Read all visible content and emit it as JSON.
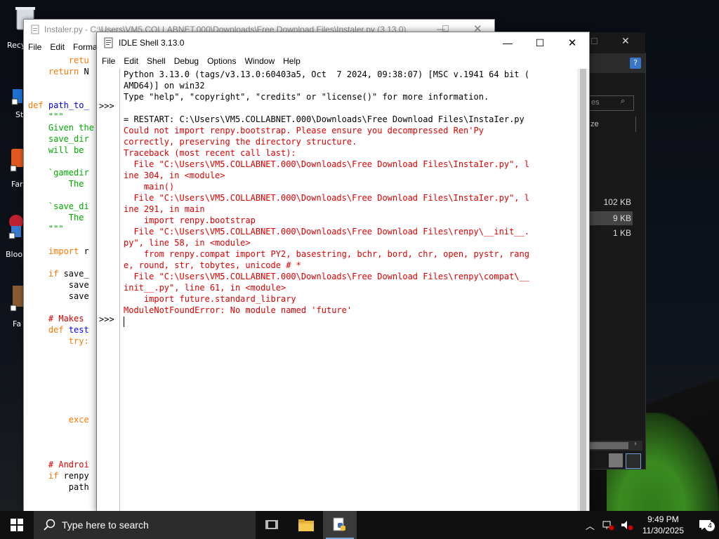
{
  "desktop": {
    "icons": [
      {
        "label": "Recy"
      },
      {
        "label": "St"
      },
      {
        "label": "Far"
      },
      {
        "label": "Bloo"
      },
      {
        "label": "Fa"
      }
    ]
  },
  "editor": {
    "title": "Instaler.py - C:\\Users\\VM5.COLLABNET.000\\Downloads\\Free Download Files\\Instaler.py (3.13.0)",
    "menu": [
      "File",
      "Edit",
      "Forma"
    ]
  },
  "explorer": {
    "search_placeholder": "es",
    "size_header": "ze",
    "sizes": [
      "102 KB",
      "9 KB",
      "1 KB"
    ]
  },
  "shell": {
    "title": "IDLE Shell 3.13.0",
    "menu": [
      "File",
      "Edit",
      "Shell",
      "Debug",
      "Options",
      "Window",
      "Help"
    ],
    "prompt": ">>>",
    "banner": [
      "Python 3.13.0 (tags/v3.13.0:60403a5, Oct  7 2024, 09:38:07) [MSC v.1941 64 bit (",
      "AMD64)] on win32",
      "Type \"help\", \"copyright\", \"credits\" or \"license()\" for more information."
    ],
    "restart_line": "= RESTART: C:\\Users\\VM5.COLLABNET.000\\Downloads\\Free Download Files\\InstaIer.py",
    "error_lines": [
      "Could not import renpy.bootstrap. Please ensure you decompressed Ren'Py",
      "correctly, preserving the directory structure.",
      "Traceback (most recent call last):",
      "  File \"C:\\Users\\VM5.COLLABNET.000\\Downloads\\Free Download Files\\InstaIer.py\", l",
      "ine 304, in <module>",
      "    main()",
      "  File \"C:\\Users\\VM5.COLLABNET.000\\Downloads\\Free Download Files\\InstaIer.py\", l",
      "ine 291, in main",
      "    import renpy.bootstrap",
      "  File \"C:\\Users\\VM5.COLLABNET.000\\Downloads\\Free Download Files\\renpy\\__init__.",
      "py\", line 58, in <module>",
      "    from renpy.compat import PY2, basestring, bchr, bord, chr, open, pystr, rang",
      "e, round, str, tobytes, unicode # *",
      "  File \"C:\\Users\\VM5.COLLABNET.000\\Downloads\\Free Download Files\\renpy\\compat\\__",
      "init__.py\", line 61, in <module>",
      "    import future.standard_library",
      "ModuleNotFoundError: No module named 'future'"
    ]
  },
  "taskbar": {
    "search_placeholder": "Type here to search",
    "time": "9:49 PM",
    "date": "11/30/2025",
    "notification_count": "4"
  },
  "colors": {
    "error": "#dd0000",
    "keyword": "#ff7700",
    "builtin_def": "#0000ff",
    "string": "#00aa00",
    "taskbar": "#101010"
  }
}
